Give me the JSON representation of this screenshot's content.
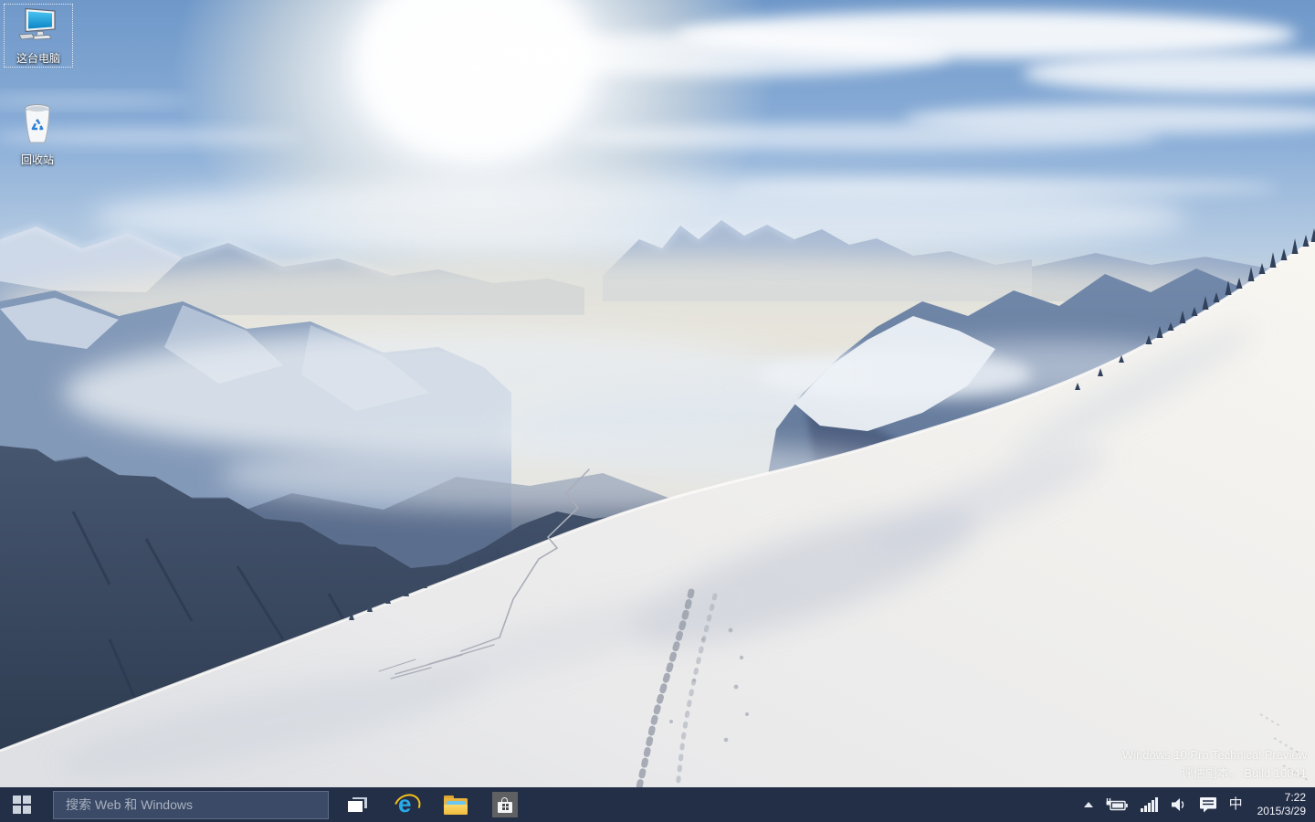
{
  "desktop": {
    "icons": [
      {
        "name": "this-pc",
        "label": "这台电脑"
      },
      {
        "name": "recycle-bin",
        "label": "回收站"
      }
    ],
    "watermark": {
      "line1": "Windows 10 Pro Technical Preview",
      "line2": "评估副本。 Build 10041"
    }
  },
  "taskbar": {
    "search": {
      "placeholder": "搜索 Web 和 Windows"
    },
    "apps": [
      {
        "name": "task-view"
      },
      {
        "name": "internet-explorer"
      },
      {
        "name": "file-explorer"
      },
      {
        "name": "store"
      }
    ],
    "icons": {
      "ie_glyph": "e",
      "ime_indicator": "中"
    },
    "clock": {
      "time": "7:22",
      "date": "2015/3/29"
    }
  },
  "colors": {
    "taskbar_bg": "#232e47",
    "search_box_bg": "#3b4a66",
    "search_placeholder": "#a9b1bf",
    "ie_blue": "#2aa9e8",
    "ie_yellow": "#f6c21a",
    "folder_yellow": "#f0bc3c",
    "store_gray": "#5e6062",
    "monitor_screen_blue": "#2aa9e0",
    "recycle_arrows_blue": "#2f80d4",
    "sky_blue": "#6f98c9"
  }
}
